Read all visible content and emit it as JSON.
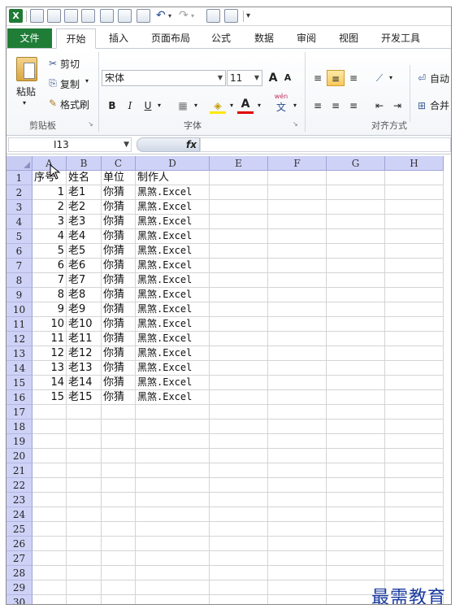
{
  "quick_access": {
    "customize_glyph": "▾"
  },
  "tabs": [
    {
      "label": "文件",
      "active": false,
      "file": true
    },
    {
      "label": "开始",
      "active": true
    },
    {
      "label": "插入",
      "active": false
    },
    {
      "label": "页面布局",
      "active": false
    },
    {
      "label": "公式",
      "active": false
    },
    {
      "label": "数据",
      "active": false
    },
    {
      "label": "审阅",
      "active": false
    },
    {
      "label": "视图",
      "active": false
    },
    {
      "label": "开发工具",
      "active": false
    }
  ],
  "ribbon": {
    "clipboard": {
      "paste_label": "粘贴",
      "cut_label": "剪切",
      "copy_label": "复制",
      "format_painter_label": "格式刷",
      "group_label": "剪贴板"
    },
    "font": {
      "font_name": "宋体",
      "font_size": "11",
      "bold": "B",
      "italic": "I",
      "underline": "U",
      "font_color_letter": "A",
      "phonetic": "wén",
      "phonetic_char": "文",
      "grow_font": "A",
      "shrink_font": "A",
      "group_label": "字体"
    },
    "alignment": {
      "wrap_label": "自动",
      "merge_label": "合并",
      "group_label": "对齐方式"
    }
  },
  "formula_bar": {
    "name_box": "I13",
    "fx": "fx",
    "formula": ""
  },
  "columns": [
    "A",
    "B",
    "C",
    "D",
    "E",
    "F",
    "G",
    "H"
  ],
  "sheet_rows": [
    {
      "row": "1",
      "a": "序号",
      "b": "姓名",
      "c": "单位",
      "d": "制作人"
    },
    {
      "row": "2",
      "a": "1",
      "b": "老1",
      "c": "你猜",
      "d": "黑煞.Excel"
    },
    {
      "row": "3",
      "a": "2",
      "b": "老2",
      "c": "你猜",
      "d": "黑煞.Excel"
    },
    {
      "row": "4",
      "a": "3",
      "b": "老3",
      "c": "你猜",
      "d": "黑煞.Excel"
    },
    {
      "row": "5",
      "a": "4",
      "b": "老4",
      "c": "你猜",
      "d": "黑煞.Excel"
    },
    {
      "row": "6",
      "a": "5",
      "b": "老5",
      "c": "你猜",
      "d": "黑煞.Excel"
    },
    {
      "row": "7",
      "a": "6",
      "b": "老6",
      "c": "你猜",
      "d": "黑煞.Excel"
    },
    {
      "row": "8",
      "a": "7",
      "b": "老7",
      "c": "你猜",
      "d": "黑煞.Excel"
    },
    {
      "row": "9",
      "a": "8",
      "b": "老8",
      "c": "你猜",
      "d": "黑煞.Excel"
    },
    {
      "row": "10",
      "a": "9",
      "b": "老9",
      "c": "你猜",
      "d": "黑煞.Excel"
    },
    {
      "row": "11",
      "a": "10",
      "b": "老10",
      "c": "你猜",
      "d": "黑煞.Excel"
    },
    {
      "row": "12",
      "a": "11",
      "b": "老11",
      "c": "你猜",
      "d": "黑煞.Excel"
    },
    {
      "row": "13",
      "a": "12",
      "b": "老12",
      "c": "你猜",
      "d": "黑煞.Excel"
    },
    {
      "row": "14",
      "a": "13",
      "b": "老13",
      "c": "你猜",
      "d": "黑煞.Excel"
    },
    {
      "row": "15",
      "a": "14",
      "b": "老14",
      "c": "你猜",
      "d": "黑煞.Excel"
    },
    {
      "row": "16",
      "a": "15",
      "b": "老15",
      "c": "你猜",
      "d": "黑煞.Excel"
    },
    {
      "row": "17",
      "a": "",
      "b": "",
      "c": "",
      "d": ""
    },
    {
      "row": "18",
      "a": "",
      "b": "",
      "c": "",
      "d": ""
    },
    {
      "row": "19",
      "a": "",
      "b": "",
      "c": "",
      "d": ""
    },
    {
      "row": "20",
      "a": "",
      "b": "",
      "c": "",
      "d": ""
    },
    {
      "row": "21",
      "a": "",
      "b": "",
      "c": "",
      "d": ""
    },
    {
      "row": "22",
      "a": "",
      "b": "",
      "c": "",
      "d": ""
    },
    {
      "row": "23",
      "a": "",
      "b": "",
      "c": "",
      "d": ""
    },
    {
      "row": "24",
      "a": "",
      "b": "",
      "c": "",
      "d": ""
    },
    {
      "row": "25",
      "a": "",
      "b": "",
      "c": "",
      "d": ""
    },
    {
      "row": "26",
      "a": "",
      "b": "",
      "c": "",
      "d": ""
    },
    {
      "row": "27",
      "a": "",
      "b": "",
      "c": "",
      "d": ""
    },
    {
      "row": "28",
      "a": "",
      "b": "",
      "c": "",
      "d": ""
    },
    {
      "row": "29",
      "a": "",
      "b": "",
      "c": "",
      "d": ""
    },
    {
      "row": "30",
      "a": "",
      "b": "",
      "c": "",
      "d": ""
    }
  ],
  "watermark": "最需教育",
  "colors": {
    "file_tab": "#1f7d37",
    "header_fill": "#cfd2f7",
    "watermark": "#1a3aa0"
  }
}
